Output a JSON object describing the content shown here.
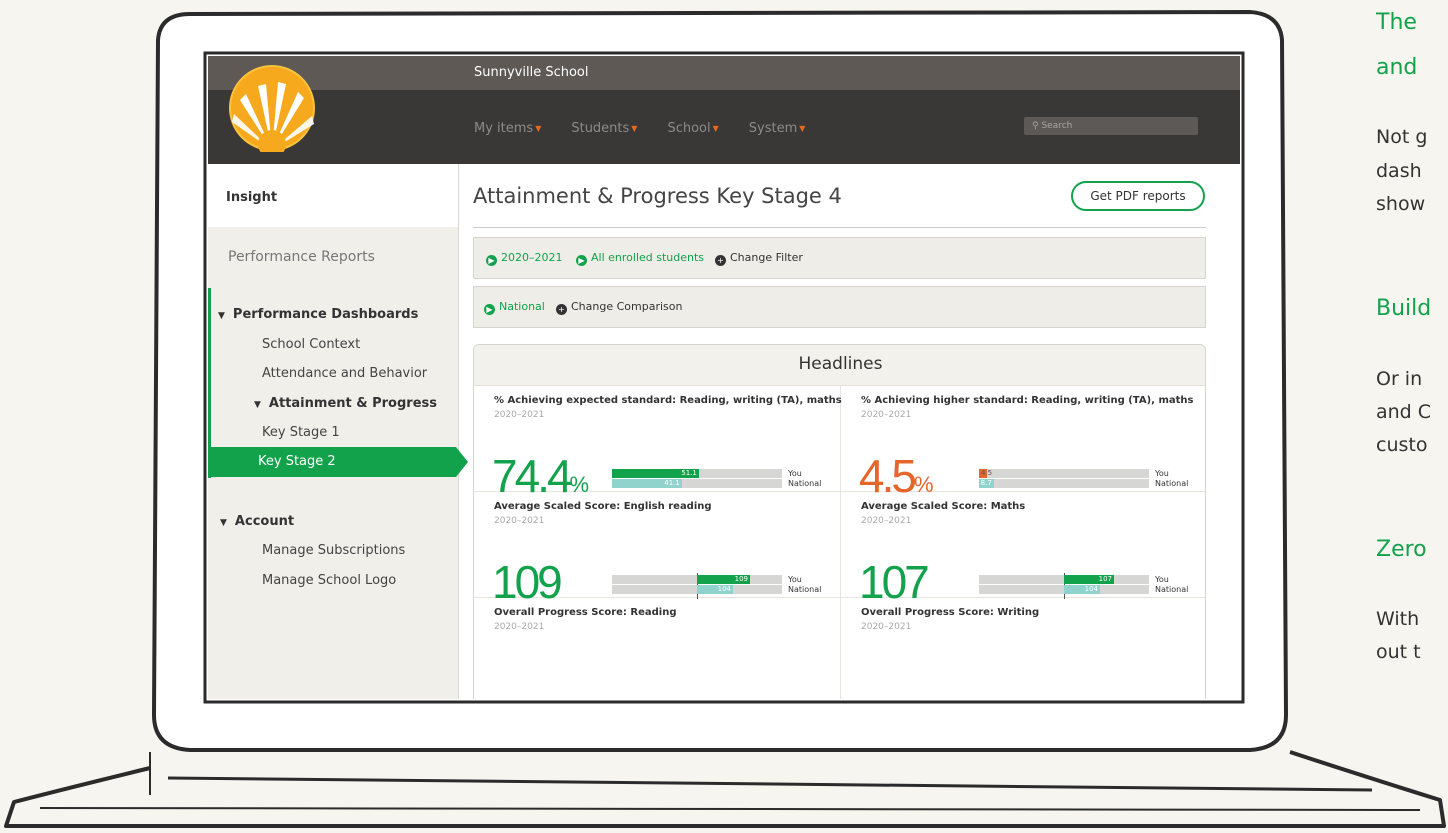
{
  "colors": {
    "brand_green": "#12a24b",
    "accent_orange": "#e6652a",
    "national_teal": "#8fd3cc",
    "nav_bg": "#3a3836",
    "topbar_bg": "#5e5955"
  },
  "app": {
    "school_name": "Sunnyville School",
    "logo_icon": "sun-logo-icon",
    "nav": [
      {
        "label": "My items"
      },
      {
        "label": "Students"
      },
      {
        "label": "School"
      },
      {
        "label": "System"
      }
    ],
    "search_placeholder": "Search"
  },
  "sidebar": {
    "header": "Insight",
    "section": "Performance Reports",
    "dashboards": "Performance Dashboards",
    "school_context": "School Context",
    "attendance": "Attendance and Behavior",
    "attainment": "Attainment & Progress",
    "ks1": "Key Stage 1",
    "ks2": "Key Stage 2",
    "account": "Account",
    "manage_subs": "Manage Subscriptions",
    "manage_logo": "Manage School Logo"
  },
  "page": {
    "title": "Attainment & Progress Key Stage 4",
    "pdf_button": "Get PDF reports",
    "filter": {
      "year": "2020–2021",
      "students": "All enrolled students",
      "change": "Change Filter"
    },
    "comparison": {
      "value": "National",
      "change": "Change Comparison"
    }
  },
  "headlines": {
    "title": "Headlines",
    "you_label": "You",
    "national_label": "National",
    "cards": [
      {
        "title": "% Achieving expected standard: Reading, writing (TA), maths",
        "year": "2020–2021",
        "big": "74.4",
        "unit": "%",
        "you_value": "51.1",
        "national_value": "41.1",
        "you_fraction": 0.511,
        "national_fraction": 0.411
      },
      {
        "title": "% Achieving higher standard: Reading, writing (TA), maths",
        "year": "2020–2021",
        "big": "4.5",
        "unit": "%",
        "you_value": "4.5",
        "national_value": "8.7",
        "you_fraction": 0.045,
        "national_fraction": 0.087
      },
      {
        "title": "Average Scaled Score: English reading",
        "year": "2020–2021",
        "big": "109",
        "you_value": "109",
        "national_value": "104"
      },
      {
        "title": "Average Scaled Score: Maths",
        "year": "2020–2021",
        "big": "107",
        "you_value": "107",
        "national_value": "104"
      },
      {
        "title": "Overall Progress Score: Reading",
        "year": "2020–2021"
      },
      {
        "title": "Overall Progress Score: Writing",
        "year": "2020–2021"
      }
    ]
  },
  "right_panel": {
    "h1_line1": "The",
    "h1_line2": "and",
    "p1_line1": "Not g",
    "p1_line2": "dash",
    "p1_line3": "show",
    "h2": "Build",
    "p2_line1": "Or in",
    "p2_line2": "and C",
    "p2_line3": "custo",
    "h3": "Zero",
    "p3_line1": "With",
    "p3_line2": "out t"
  }
}
